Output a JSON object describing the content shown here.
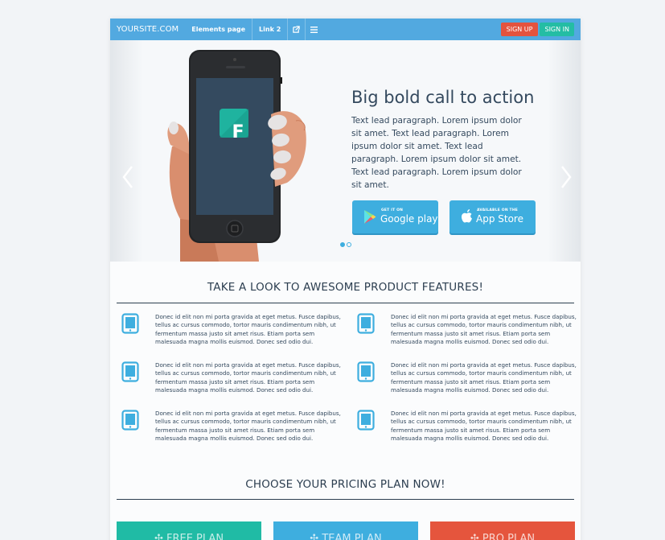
{
  "navbar": {
    "brand": "YOURSITE.COM",
    "links": [
      "Elements page",
      "Link 2"
    ],
    "icons": [
      "external-link-icon",
      "menu-icon"
    ],
    "signup": "SIGN UP",
    "signin": "SIGN IN"
  },
  "hero": {
    "title": "Big bold call to action",
    "lead": "Text lead paragraph. Lorem ipsum dolor sit amet. Text lead paragraph. Lorem ipsum dolor sit amet. Text lead paragraph. Lorem ipsum dolor sit amet. Text lead paragraph. Lorem ipsum dolor sit amet.",
    "app_letter": "F",
    "google": {
      "small": "GET IT ON",
      "big": "Google play"
    },
    "apple": {
      "small": "AVAILABLE ON THE",
      "big": "App Store"
    },
    "slides": 2,
    "active_slide": 1
  },
  "features": {
    "title": "TAKE A LOOK TO AWESOME PRODUCT FEATURES!",
    "items": [
      "Donec id elit non mi porta gravida at eget metus. Fusce dapibus, tellus ac cursus commodo, tortor mauris condimentum nibh, ut fermentum massa justo sit amet risus. Etiam porta sem malesuada magna mollis euismod. Donec sed odio dui.",
      "Donec id elit non mi porta gravida at eget metus. Fusce dapibus, tellus ac cursus commodo, tortor mauris condimentum nibh, ut fermentum massa justo sit amet risus. Etiam porta sem malesuada magna mollis euismod. Donec sed odio dui.",
      "Donec id elit non mi porta gravida at eget metus. Fusce dapibus, tellus ac cursus commodo, tortor mauris condimentum nibh, ut fermentum massa justo sit amet risus. Etiam porta sem malesuada magna mollis euismod. Donec sed odio dui.",
      "Donec id elit non mi porta gravida at eget metus. Fusce dapibus, tellus ac cursus commodo, tortor mauris condimentum nibh, ut fermentum massa justo sit amet risus. Etiam porta sem malesuada magna mollis euismod. Donec sed odio dui.",
      "Donec id elit non mi porta gravida at eget metus. Fusce dapibus, tellus ac cursus commodo, tortor mauris condimentum nibh, ut fermentum massa justo sit amet risus. Etiam porta sem malesuada magna mollis euismod. Donec sed odio dui.",
      "Donec id elit non mi porta gravida at eget metus. Fusce dapibus, tellus ac cursus commodo, tortor mauris condimentum nibh, ut fermentum massa justo sit amet risus. Etiam porta sem malesuada magna mollis euismod. Donec sed odio dui."
    ],
    "icon": "tablet-icon"
  },
  "pricing": {
    "title": "CHOOSE YOUR PRICING PLAN NOW!",
    "plans": [
      {
        "label": "FREE PLAN",
        "color": "#20bba5"
      },
      {
        "label": "TEAM PLAN",
        "color": "#3eaedf"
      },
      {
        "label": "PRO PLAN",
        "color": "#e5553d"
      }
    ]
  },
  "colors": {
    "navbar": "#52a9e0",
    "signup": "#e4533e",
    "signin": "#24bda4",
    "text": "#34495e",
    "accent": "#3eaedf"
  }
}
